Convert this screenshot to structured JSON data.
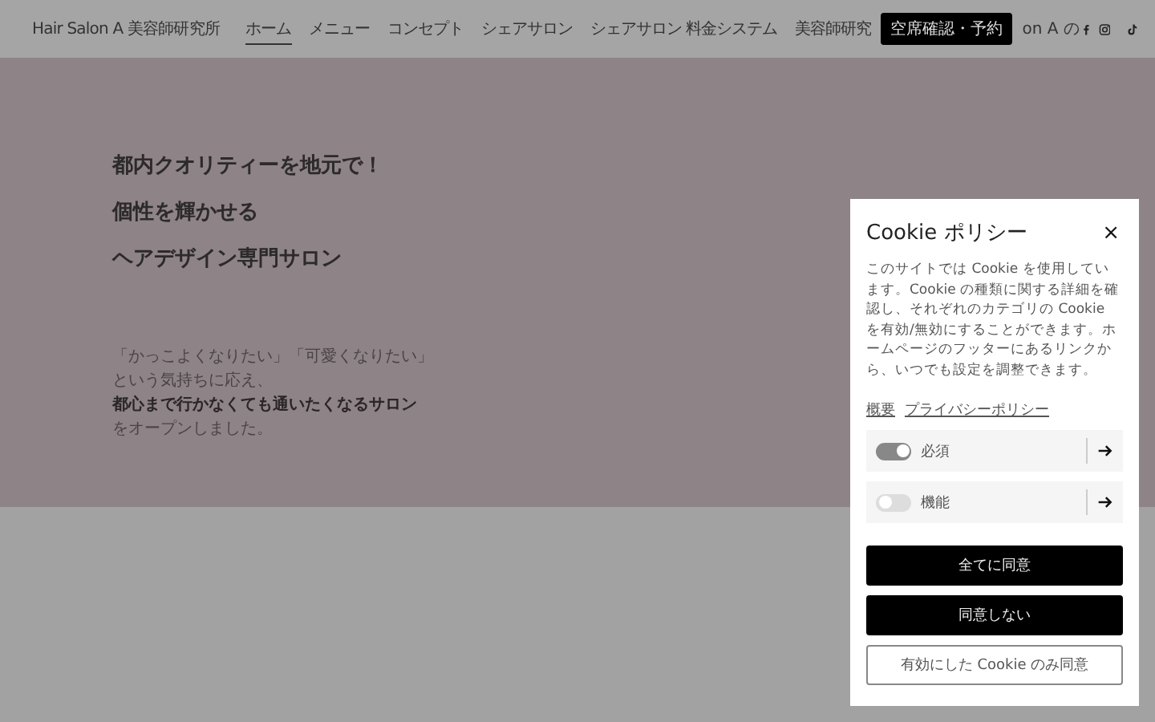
{
  "header": {
    "logo": "Hair Salon A 美容師研究所",
    "nav": [
      {
        "label": "ホーム",
        "selected": true
      },
      {
        "label": "メニュー",
        "selected": false
      },
      {
        "label": "コンセプト",
        "selected": false
      },
      {
        "label": "シェアサロン",
        "selected": false
      },
      {
        "label": "シェアサロン 料金システム",
        "selected": false
      },
      {
        "label": "美容師研究",
        "selected": false
      }
    ],
    "reserve_button": "空席確認・予約",
    "nav_tail": "on A の"
  },
  "hero": {
    "headlines": [
      "都内クオリティーを地元で！",
      "個性を輝かせる",
      "ヘアデザイン専門サロン"
    ],
    "body": [
      {
        "text": "「かっこよくなりたい」「可愛くなりたい」",
        "bold": false
      },
      {
        "text": "という気持ちに応え、",
        "bold": false
      },
      {
        "text": "都心まで行かなくても通いたくなるサロン",
        "bold": true
      },
      {
        "text": "をオープンしました。",
        "bold": false
      }
    ]
  },
  "cookie": {
    "title": "Cookie ポリシー",
    "close": "×",
    "text": "このサイトでは Cookie を使用しています。Cookie の種類に関する詳細を確認し、それぞれのカテゴリの Cookie を有効/無効にすることができます。ホームページのフッターにあるリンクから、いつでも設定を調整できます。",
    "links": [
      "概要",
      "プライバシーポリシー"
    ],
    "categories": [
      {
        "label": "必須",
        "on": true
      },
      {
        "label": "機能",
        "on": false
      }
    ],
    "buttons": [
      {
        "label": "全てに同意",
        "kind": "solid"
      },
      {
        "label": "同意しない",
        "kind": "solid"
      },
      {
        "label": "有効にした Cookie のみ同意",
        "kind": "outline"
      }
    ]
  }
}
